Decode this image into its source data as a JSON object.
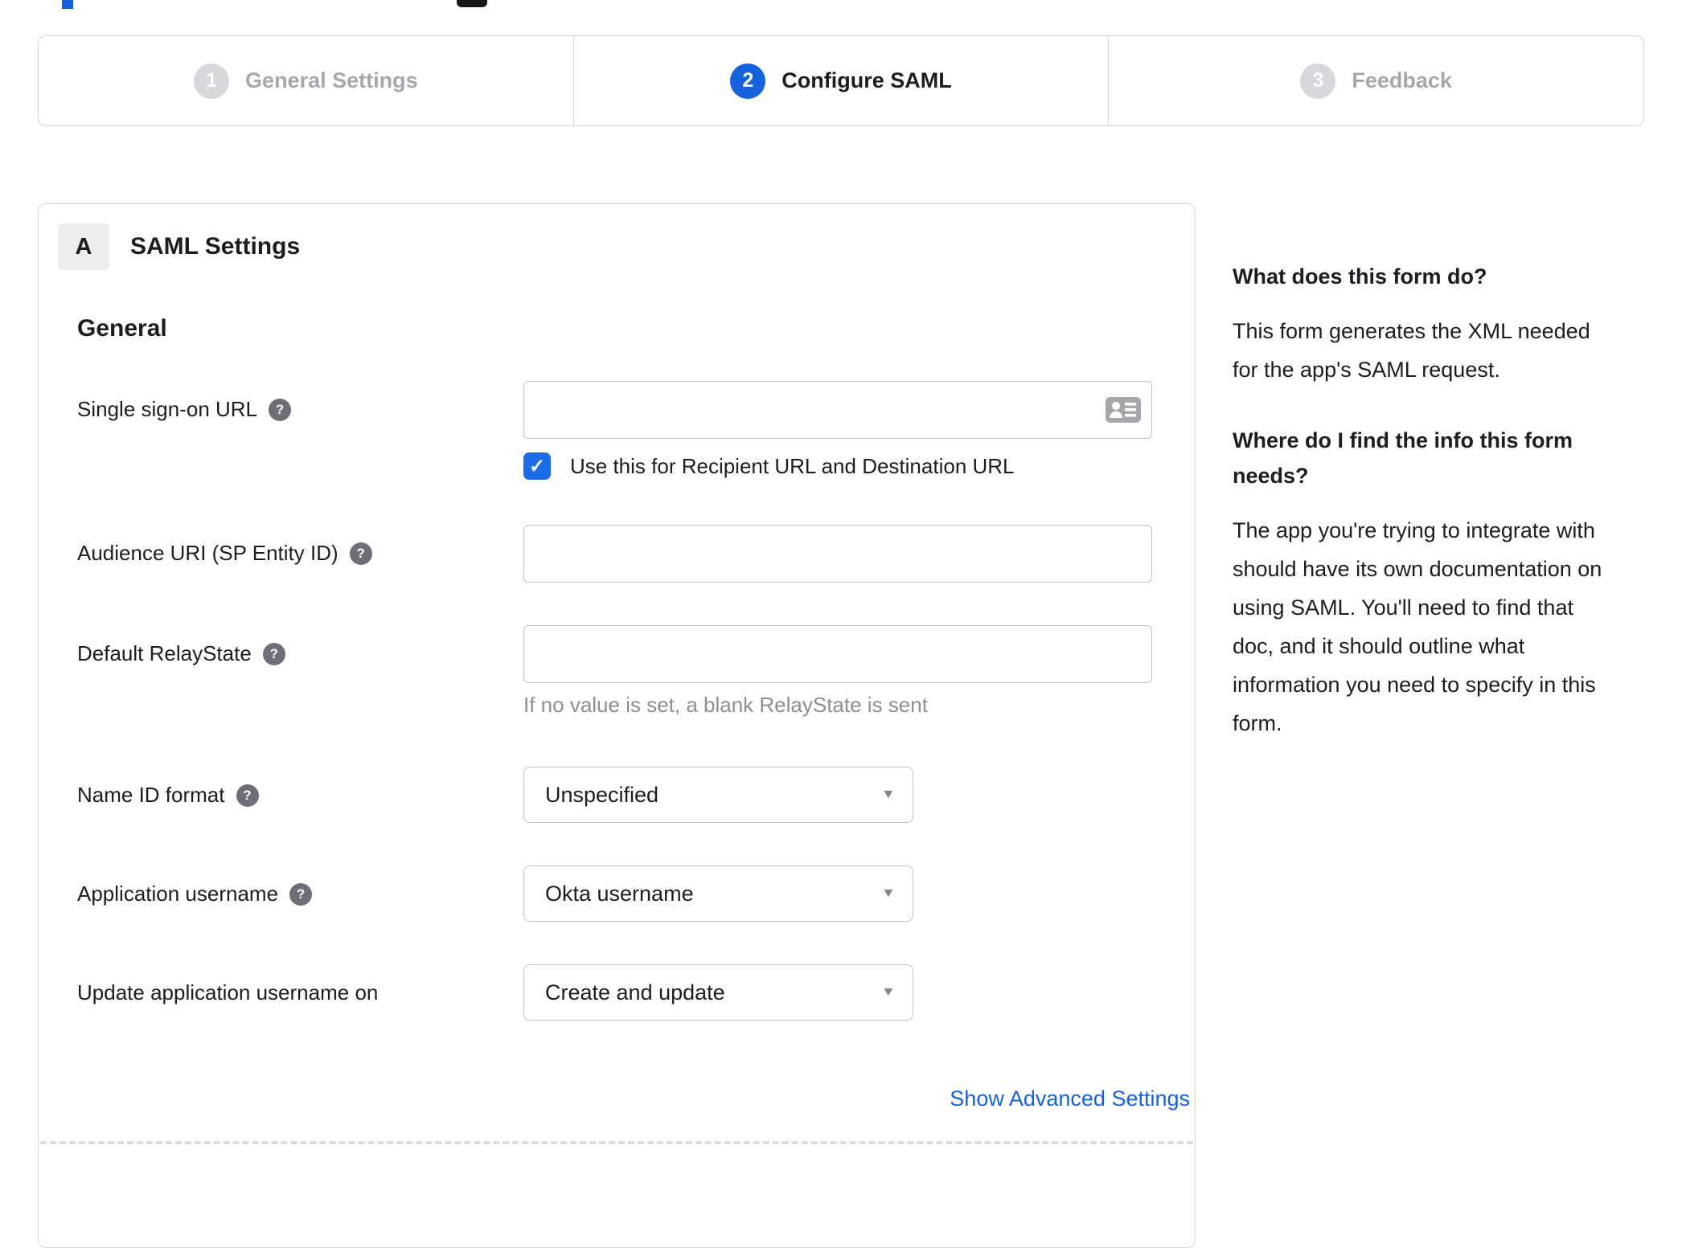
{
  "colors": {
    "accent_blue": "#1662dd",
    "checkbox_blue": "#1c6ce8",
    "link_blue": "#1661de",
    "inactive_gray": "#d7d7dc"
  },
  "icons": {
    "help": "?",
    "caret": "▼",
    "check": "✓",
    "input_icon_name": "contact-card-icon"
  },
  "stepper": {
    "steps": [
      {
        "number": "1",
        "label": "General Settings",
        "state": "inactive"
      },
      {
        "number": "2",
        "label": "Configure SAML",
        "state": "active"
      },
      {
        "number": "3",
        "label": "Feedback",
        "state": "inactive"
      }
    ]
  },
  "panel": {
    "badge": "A",
    "title": "SAML Settings",
    "group": "General",
    "fields": {
      "sso": {
        "label": "Single sign-on URL",
        "value": "",
        "placeholder": "",
        "checkbox_label": "Use this for Recipient URL and Destination URL",
        "checkbox_checked": true
      },
      "audience": {
        "label": "Audience URI (SP Entity ID)",
        "value": "",
        "placeholder": ""
      },
      "relay": {
        "label": "Default RelayState",
        "value": "",
        "placeholder": "",
        "hint": "If no value is set, a blank RelayState is sent"
      },
      "name_id": {
        "label": "Name ID format",
        "value": "Unspecified"
      },
      "app_username": {
        "label": "Application username",
        "value": "Okta username"
      },
      "update_username": {
        "label": "Update application username on",
        "value": "Create and update"
      }
    },
    "advanced_link": "Show Advanced Settings"
  },
  "sidebar": {
    "heading1": "What does this form do?",
    "p1": "This form generates the XML needed for the app's SAML request.",
    "heading2": "Where do I find the info this form needs?",
    "p2": "The app you're trying to integrate with should have its own documentation on using SAML. You'll need to find that doc, and it should outline what information you need to specify in this form."
  }
}
